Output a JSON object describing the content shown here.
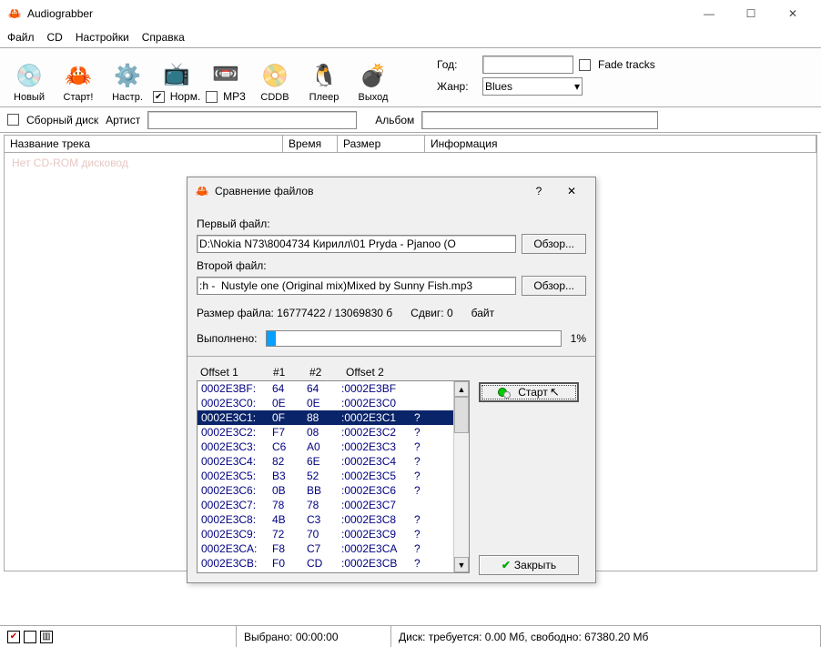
{
  "window": {
    "title": "Audiograbber"
  },
  "menu": [
    "Файл",
    "CD",
    "Настройки",
    "Справка"
  ],
  "toolbar": {
    "items": [
      {
        "label": "Новый",
        "icon": "💿"
      },
      {
        "label": "Старт!",
        "icon": "🦀"
      },
      {
        "label": "Настр.",
        "icon": "⚙️"
      },
      {
        "label": "Норм.",
        "icon": "📺",
        "check": true,
        "checked": true
      },
      {
        "label": "MP3",
        "icon": "📼",
        "check": true,
        "checked": false
      },
      {
        "label": "CDDB",
        "icon": "📀"
      },
      {
        "label": "Плеер",
        "icon": "🐧"
      },
      {
        "label": "Выход",
        "icon": "💣"
      }
    ],
    "year_label": "Год:",
    "year_value": "",
    "genre_label": "Жанр:",
    "genre_value": "Blues",
    "fade_label": "Fade tracks",
    "fade_checked": false
  },
  "filter": {
    "sbornik_label": "Сборный диск",
    "artist_label": "Артист",
    "artist_value": "",
    "album_label": "Альбом",
    "album_value": ""
  },
  "list": {
    "headers": [
      "Название трека",
      "Время",
      "Размер",
      "Информация"
    ],
    "faint": "Нет CD-ROM дисковод"
  },
  "status": {
    "selected": "Выбрано: 00:00:00",
    "disk": "Диск: требуется: 0.00 Мб, свободно: 67380.20 Мб"
  },
  "dialog": {
    "title": "Сравнение файлов",
    "first_label": "Первый файл:",
    "first_value": "D:\\Nokia N73\\8004734 Кирилл\\01 Pryda - Pjanoo (O",
    "second_label": "Второй файл:",
    "second_value": ":h -  Nustyle one (Original mix)Mixed by Sunny Fish.mp3",
    "browse": "Обзор...",
    "size_label": "Размер файла: 16777422 / 13069830 б",
    "shift_label": "Сдвиг: 0",
    "bytes_label": "байт",
    "done_label": "Выполнено:",
    "progress_pct": "1%",
    "hex_headers": [
      "Offset 1",
      "#1",
      "#2",
      "Offset 2"
    ],
    "hex_rows": [
      [
        "0002E3BF:",
        "64",
        "64",
        ":0002E3BF",
        ""
      ],
      [
        "0002E3C0:",
        "0E",
        "0E",
        ":0002E3C0",
        ""
      ],
      [
        "0002E3C1:",
        "0F",
        "88",
        ":0002E3C1",
        "?"
      ],
      [
        "0002E3C2:",
        "F7",
        "08",
        ":0002E3C2",
        "?"
      ],
      [
        "0002E3C3:",
        "C6",
        "A0",
        ":0002E3C3",
        "?"
      ],
      [
        "0002E3C4:",
        "82",
        "6E",
        ":0002E3C4",
        "?"
      ],
      [
        "0002E3C5:",
        "B3",
        "52",
        ":0002E3C5",
        "?"
      ],
      [
        "0002E3C6:",
        "0B",
        "BB",
        ":0002E3C6",
        "?"
      ],
      [
        "0002E3C7:",
        "78",
        "78",
        ":0002E3C7",
        ""
      ],
      [
        "0002E3C8:",
        "4B",
        "C3",
        ":0002E3C8",
        "?"
      ],
      [
        "0002E3C9:",
        "72",
        "70",
        ":0002E3C9",
        "?"
      ],
      [
        "0002E3CA:",
        "F8",
        "C7",
        ":0002E3CA",
        "?"
      ],
      [
        "0002E3CB:",
        "F0",
        "CD",
        ":0002E3CB",
        "?"
      ]
    ],
    "selected_row": 2,
    "start_btn": "Старт",
    "close_btn": "Закрыть"
  }
}
